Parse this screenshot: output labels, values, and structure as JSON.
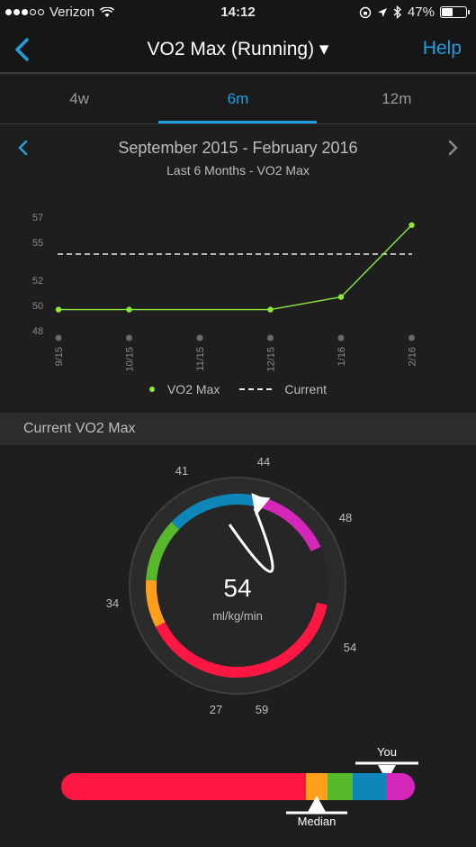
{
  "status_bar": {
    "carrier": "Verizon",
    "time": "14:12",
    "battery": "47%",
    "battery_level": 0.47
  },
  "nav": {
    "title": "VO2 Max (Running) ▾",
    "help_label": "Help"
  },
  "tabs": [
    {
      "label": "4w",
      "active": false
    },
    {
      "label": "6m",
      "active": true
    },
    {
      "label": "12m",
      "active": false
    }
  ],
  "range": {
    "dates": "September 2015 - February 2016",
    "subtitle": "Last 6 Months - VO2 Max"
  },
  "chart_data": {
    "type": "line",
    "x": [
      "9/15",
      "10/15",
      "11/15",
      "12/15",
      "1/16",
      "2/16"
    ],
    "series": [
      {
        "name": "VO2 Max",
        "color": "#8ee83a",
        "values": [
          49.6,
          49.6,
          null,
          49.6,
          50.6,
          56.3
        ]
      }
    ],
    "reference_lines": [
      {
        "name": "Current",
        "value": 54,
        "style": "dashed",
        "color": "#e8e8e8"
      }
    ],
    "y_ticks": [
      48,
      50,
      52,
      55,
      57
    ],
    "ylim": [
      48,
      57
    ],
    "legend": [
      "VO2 Max",
      "Current"
    ],
    "legend_placement": "bottom"
  },
  "section": {
    "current_label": "Current VO2 Max"
  },
  "gauge": {
    "value": "54",
    "unit": "ml/kg/min",
    "value_numeric": 54,
    "tick_labels": [
      "27",
      "34",
      "41",
      "44",
      "48",
      "54",
      "59"
    ],
    "zones": [
      {
        "color": "#ff1744",
        "from": 27,
        "to": 41
      },
      {
        "color": "#ff9f1c",
        "from": 41,
        "to": 44
      },
      {
        "color": "#57b82b",
        "from": 44,
        "to": 48
      },
      {
        "color": "#0e86ba",
        "from": 48,
        "to": 54
      },
      {
        "color": "#d426b8",
        "from": 54,
        "to": 59
      }
    ]
  },
  "comparison_bar": {
    "you_label": "You",
    "median_label": "Median"
  },
  "colors": {
    "accent": "#1e9fe0",
    "series": "#8ee83a"
  }
}
